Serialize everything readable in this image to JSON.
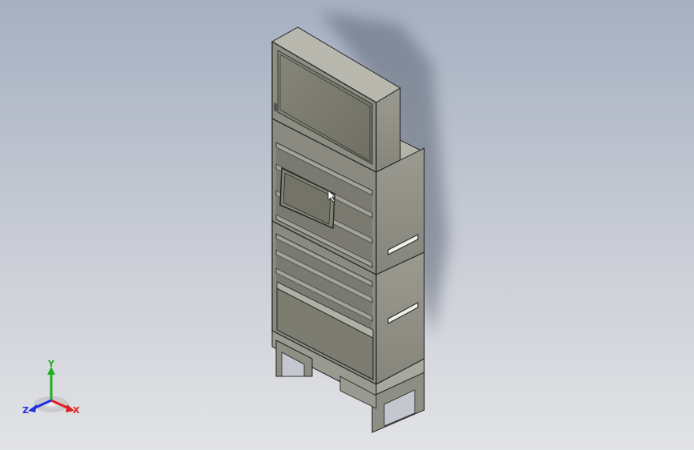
{
  "viewport": {
    "background_top": "#a6b0c2",
    "background_bottom": "#e2e3e6"
  },
  "model": {
    "description_colors": {
      "face": "#7f7f73",
      "side": "#8c8c82",
      "top": "#b4b4aa",
      "edge": "#1e1e1e",
      "shadow": "#6c7482"
    }
  },
  "triad": {
    "x_label": "X",
    "y_label": "Y",
    "z_label": "Z",
    "x_color": "#e02020",
    "y_color": "#20b020",
    "z_color": "#2030e0"
  }
}
